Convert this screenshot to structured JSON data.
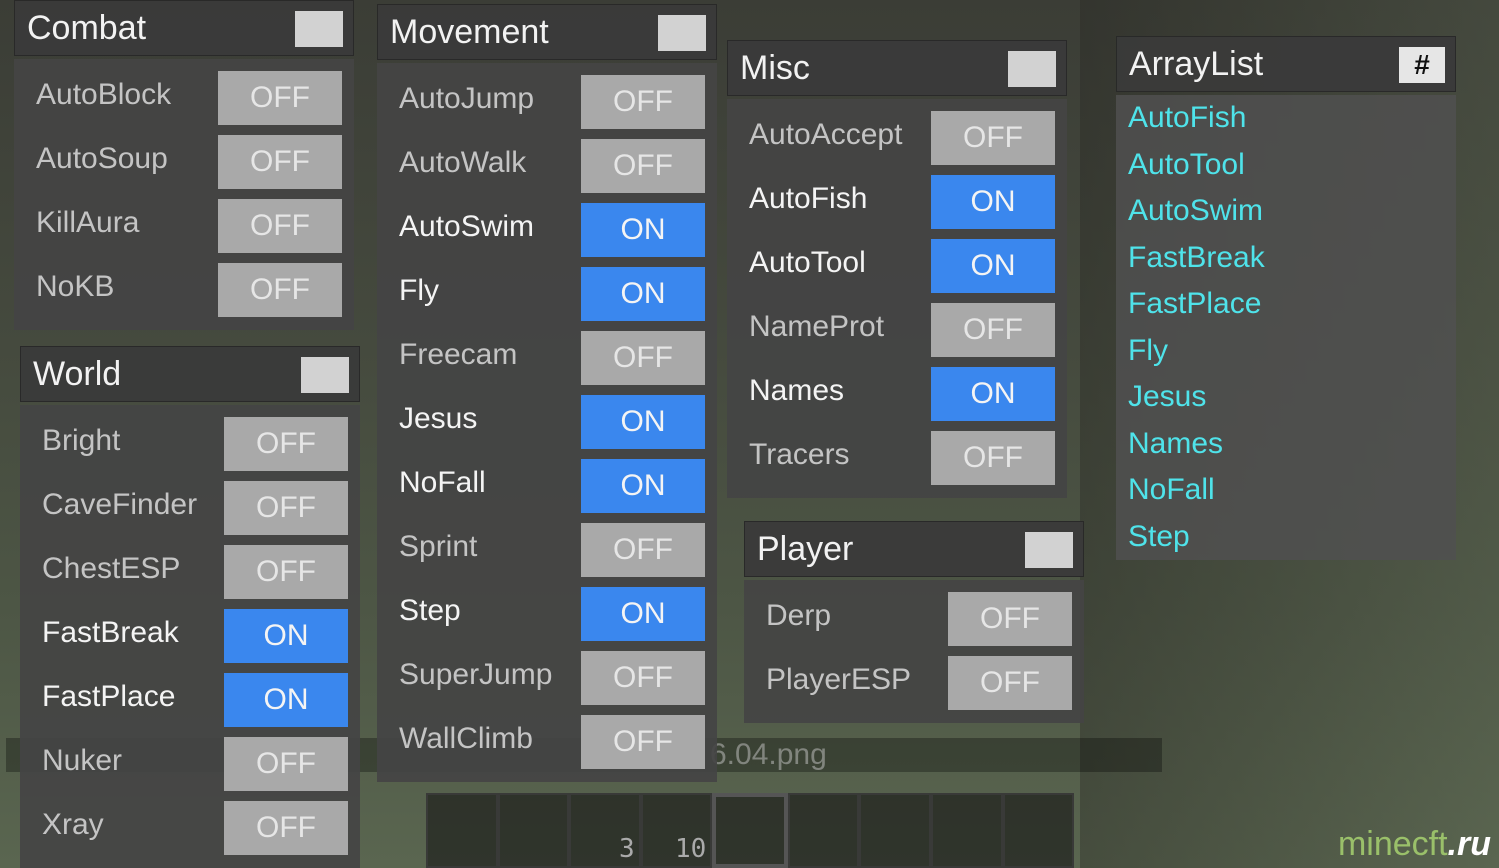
{
  "panels": {
    "combat": {
      "title": "Combat",
      "items": [
        {
          "label": "AutoBlock",
          "state": "OFF"
        },
        {
          "label": "AutoSoup",
          "state": "OFF"
        },
        {
          "label": "KillAura",
          "state": "OFF"
        },
        {
          "label": "NoKB",
          "state": "OFF"
        }
      ]
    },
    "world": {
      "title": "World",
      "items": [
        {
          "label": "Bright",
          "state": "OFF"
        },
        {
          "label": "CaveFinder",
          "state": "OFF"
        },
        {
          "label": "ChestESP",
          "state": "OFF"
        },
        {
          "label": "FastBreak",
          "state": "ON"
        },
        {
          "label": "FastPlace",
          "state": "ON"
        },
        {
          "label": "Nuker",
          "state": "OFF"
        },
        {
          "label": "Xray",
          "state": "OFF"
        }
      ]
    },
    "movement": {
      "title": "Movement",
      "items": [
        {
          "label": "AutoJump",
          "state": "OFF"
        },
        {
          "label": "AutoWalk",
          "state": "OFF"
        },
        {
          "label": "AutoSwim",
          "state": "ON"
        },
        {
          "label": "Fly",
          "state": "ON"
        },
        {
          "label": "Freecam",
          "state": "OFF"
        },
        {
          "label": "Jesus",
          "state": "ON"
        },
        {
          "label": "NoFall",
          "state": "ON"
        },
        {
          "label": "Sprint",
          "state": "OFF"
        },
        {
          "label": "Step",
          "state": "ON"
        },
        {
          "label": "SuperJump",
          "state": "OFF"
        },
        {
          "label": "WallClimb",
          "state": "OFF"
        }
      ]
    },
    "misc": {
      "title": "Misc",
      "items": [
        {
          "label": "AutoAccept",
          "state": "OFF"
        },
        {
          "label": "AutoFish",
          "state": "ON"
        },
        {
          "label": "AutoTool",
          "state": "ON"
        },
        {
          "label": "NameProt",
          "state": "OFF"
        },
        {
          "label": "Names",
          "state": "ON"
        },
        {
          "label": "Tracers",
          "state": "OFF"
        }
      ]
    },
    "player": {
      "title": "Player",
      "items": [
        {
          "label": "Derp",
          "state": "OFF"
        },
        {
          "label": "PlayerESP",
          "state": "OFF"
        }
      ]
    }
  },
  "arraylist": {
    "title": "ArrayList",
    "pin_label": "#",
    "items": [
      "AutoFish",
      "AutoTool",
      "AutoSwim",
      "FastBreak",
      "FastPlace",
      "Fly",
      "Jesus",
      "Names",
      "NoFall",
      "Step"
    ]
  },
  "chat": {
    "text": "6.04.png"
  },
  "hotbar": {
    "counts": [
      "",
      "",
      "3",
      "10",
      "",
      "",
      "",
      "",
      ""
    ]
  },
  "watermark": {
    "site": "minecft",
    "tld": ".ru"
  },
  "colors": {
    "on": "#3a87ee",
    "off": "#a9a9a9",
    "arraylist_text": "#4fe3ea"
  }
}
